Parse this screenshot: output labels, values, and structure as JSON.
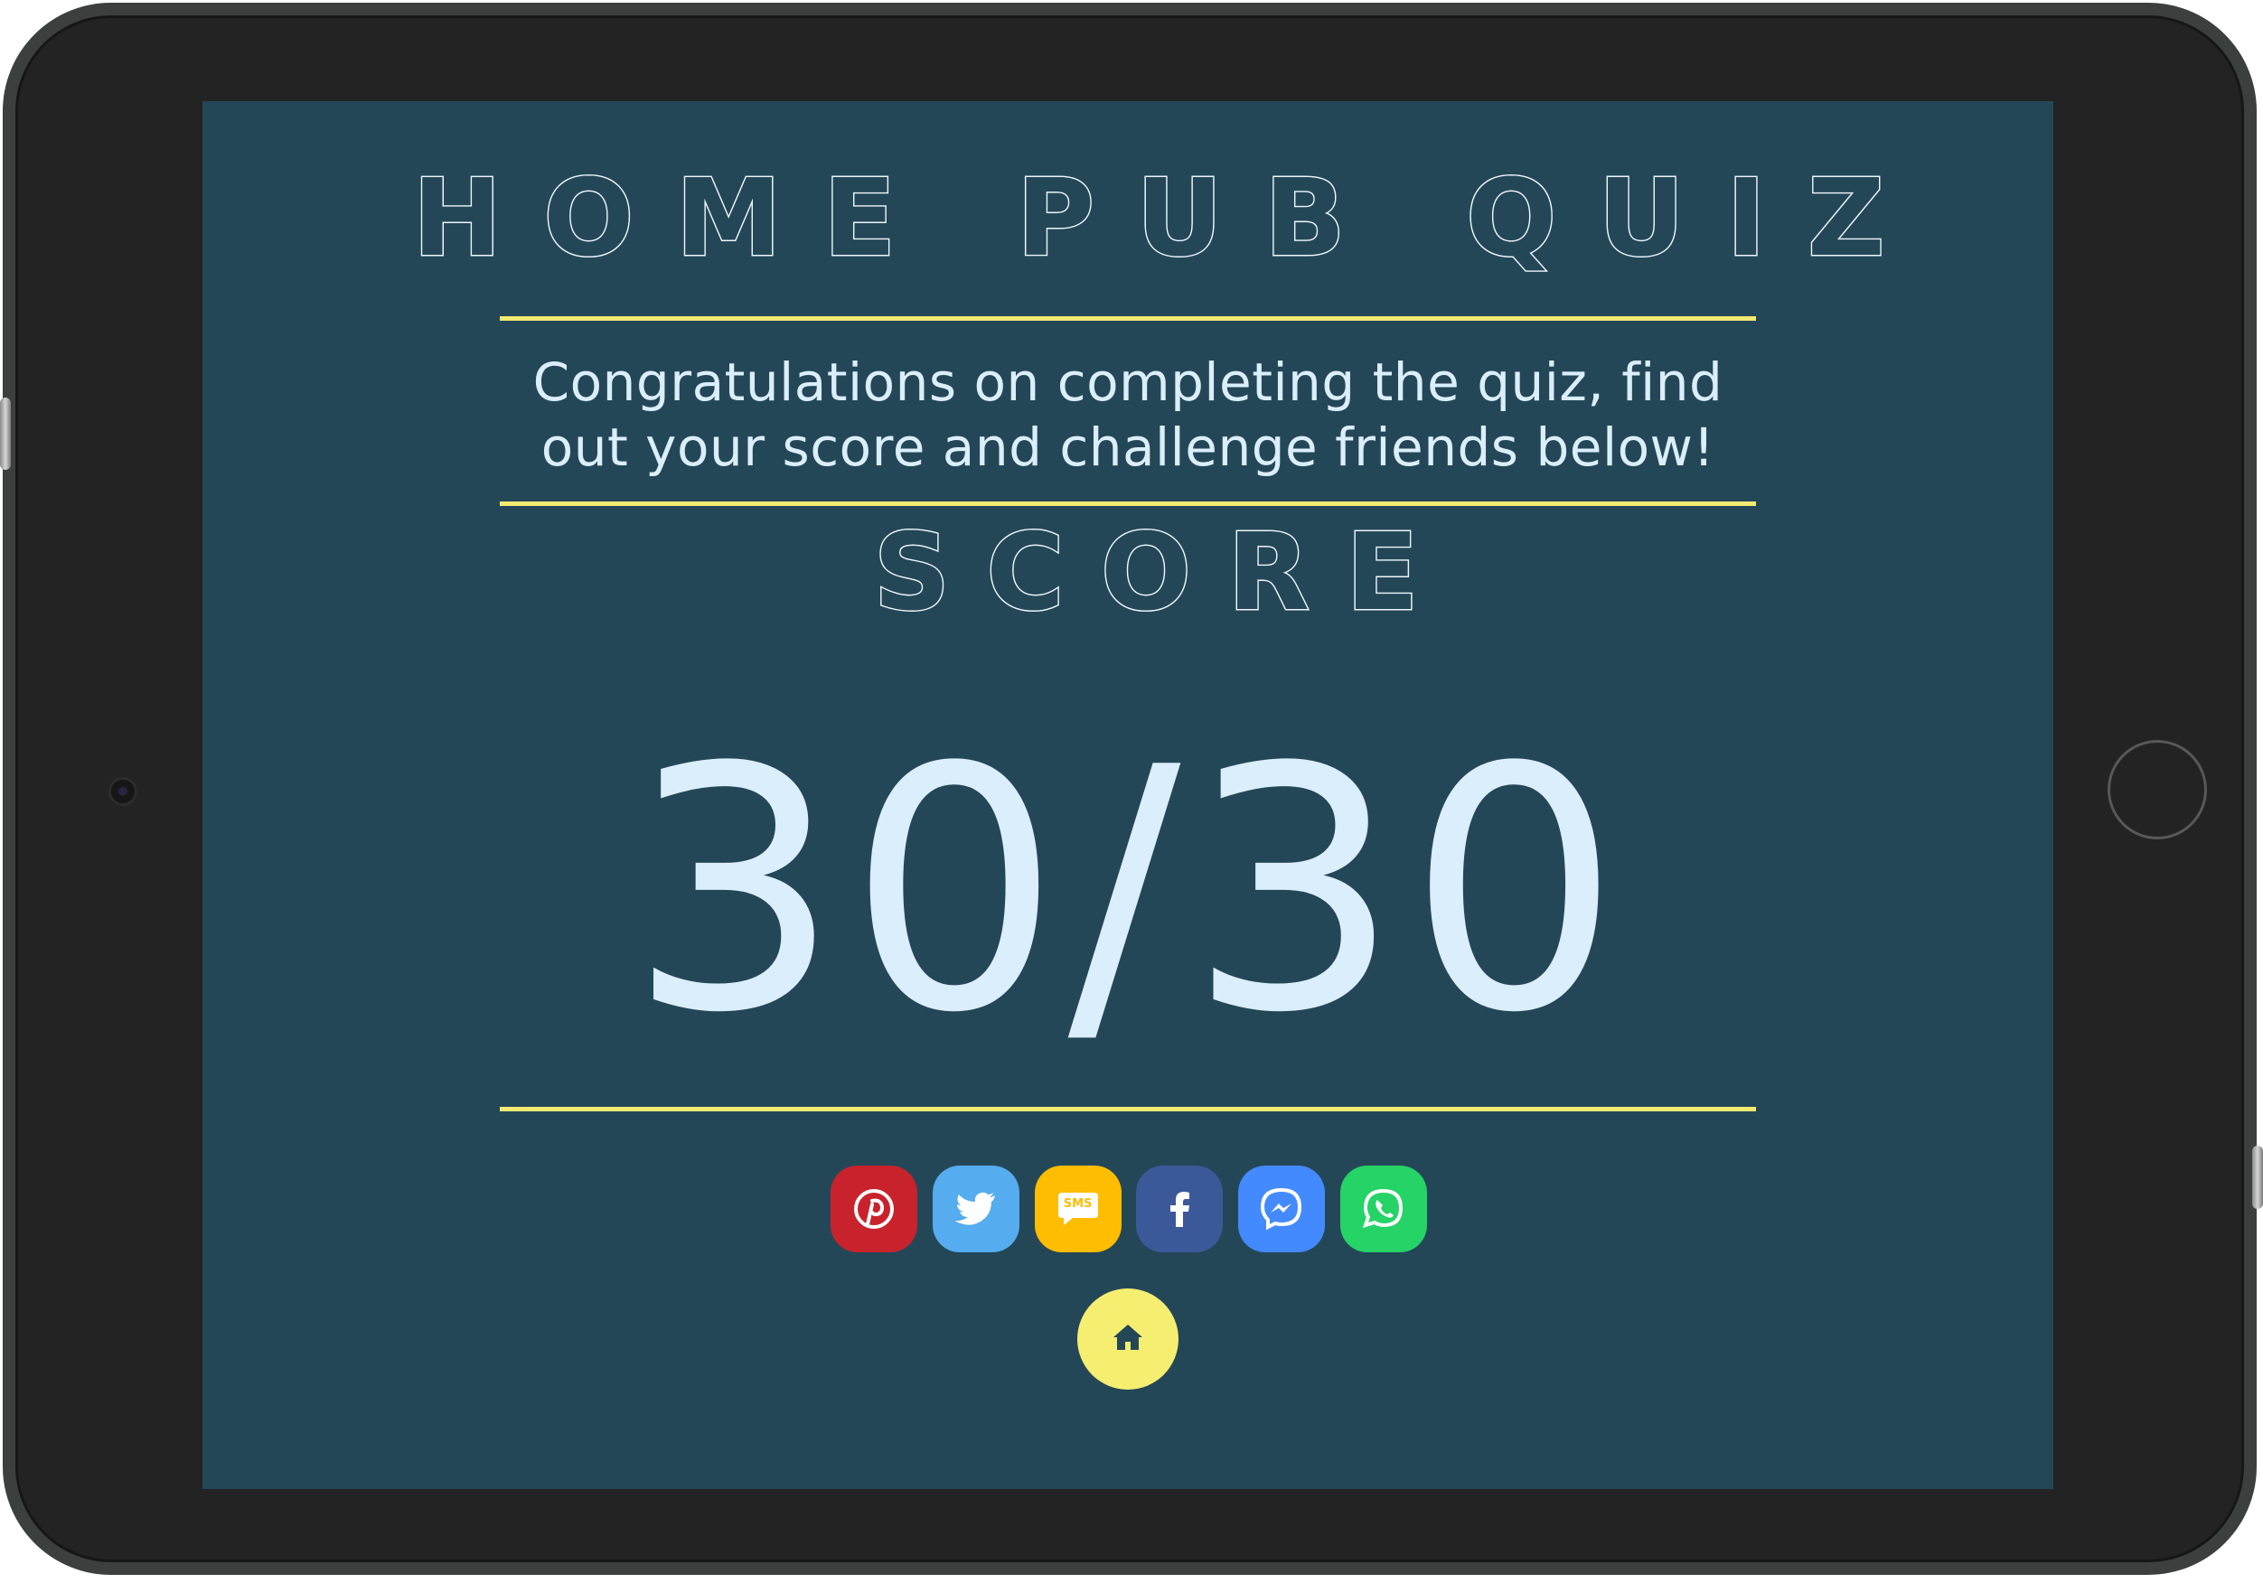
{
  "app": {
    "title": "HOME PUB QUIZ",
    "message": "Congratulations on completing the quiz, find out your score and challenge friends below!",
    "score_heading": "SCORE",
    "score_value": "30/30"
  },
  "share_buttons": [
    {
      "network": "Pinterest",
      "icon": "pinterest-icon",
      "color": "#c8232c"
    },
    {
      "network": "Twitter",
      "icon": "twitter-icon",
      "color": "#55acee"
    },
    {
      "network": "SMS",
      "icon": "sms-icon",
      "label": "SMS",
      "color": "#ffbd00"
    },
    {
      "network": "Facebook",
      "icon": "facebook-icon",
      "color": "#3b5998"
    },
    {
      "network": "Messenger",
      "icon": "messenger-icon",
      "color": "#448aff"
    },
    {
      "network": "WhatsApp",
      "icon": "whatsapp-icon",
      "color": "#25d366"
    }
  ],
  "home_button": {
    "icon": "home-icon",
    "color": "#f6ee70"
  },
  "theme": {
    "screen_background": "#244758",
    "accent_rule": "#f3ea72",
    "text": "#dbeefb"
  }
}
